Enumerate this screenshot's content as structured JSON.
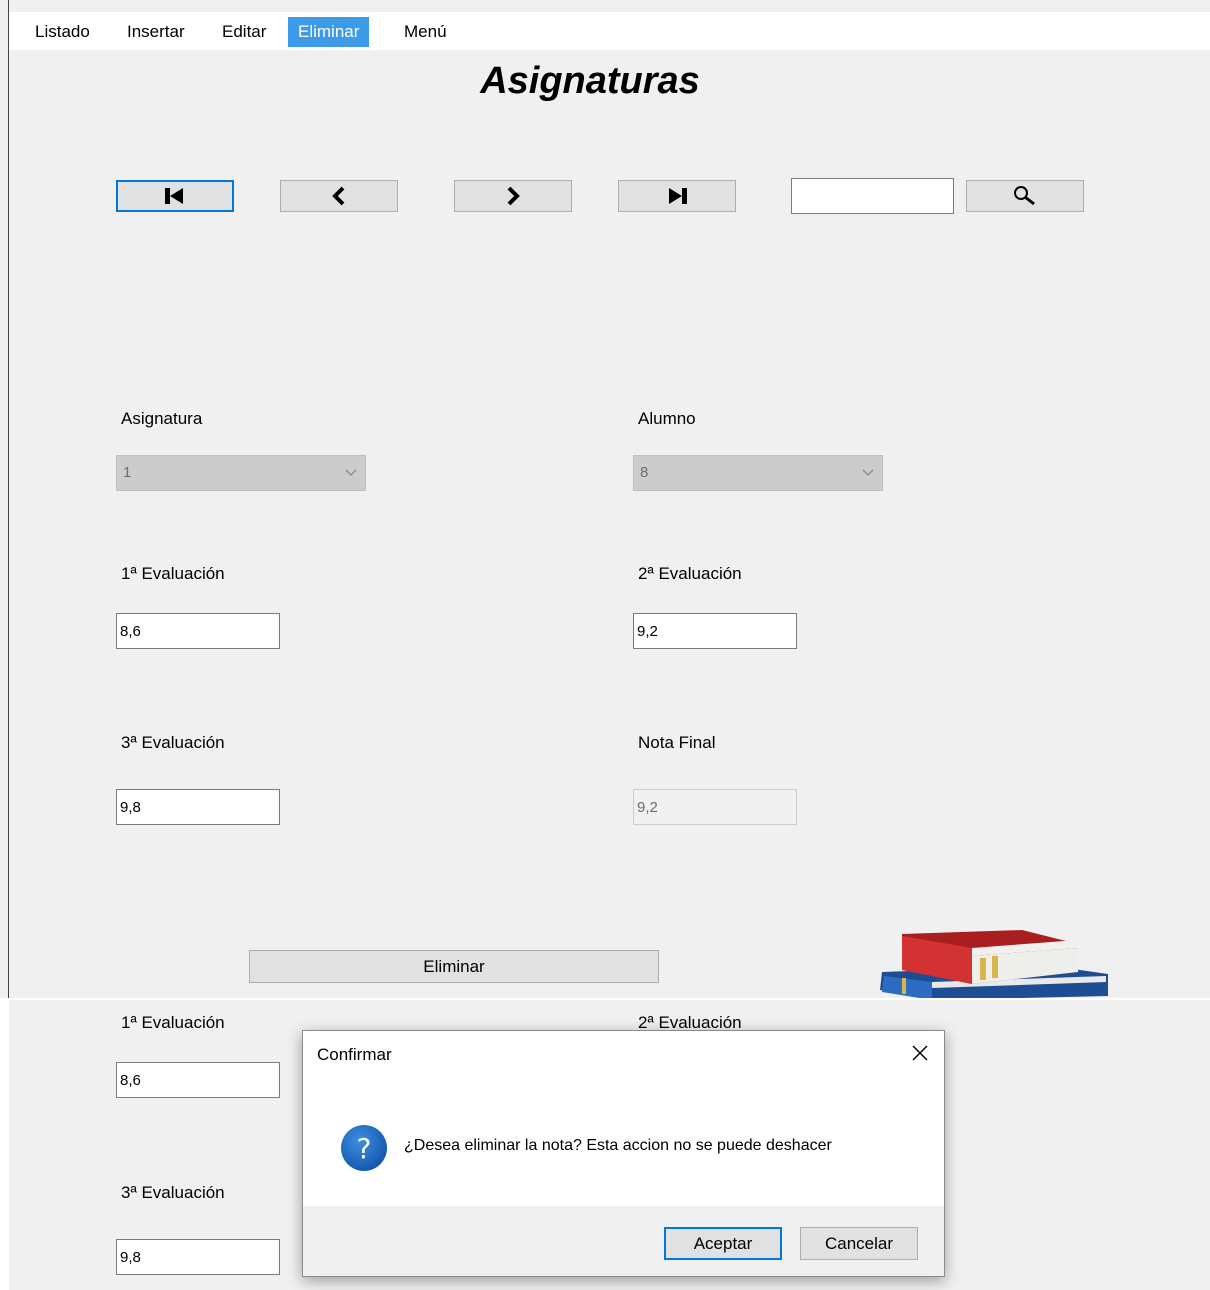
{
  "menu": {
    "items": [
      {
        "label": "Listado"
      },
      {
        "label": "Insertar"
      },
      {
        "label": "Editar"
      },
      {
        "label": "Eliminar",
        "active": true
      },
      {
        "label": "Menú"
      }
    ]
  },
  "header": {
    "title": "Asignaturas"
  },
  "nav": {
    "first_icon": "skip-first-icon",
    "prev_icon": "chevron-left-icon",
    "next_icon": "chevron-right-icon",
    "last_icon": "skip-last-icon",
    "search_value": "",
    "search_icon": "search-icon"
  },
  "form": {
    "asignatura_label": "Asignatura",
    "asignatura_value": "1",
    "alumno_label": "Alumno",
    "alumno_value": "8",
    "eval1_label": "1ª Evaluación",
    "eval1_value": "8,6",
    "eval2_label": "2ª Evaluación",
    "eval2_value": "9,2",
    "eval3_label": "3ª Evaluación",
    "eval3_value": "9,8",
    "final_label": "Nota Final",
    "final_value": "9,2",
    "delete_button": "Eliminar"
  },
  "decoration": {
    "icon": "books-icon"
  },
  "dialog": {
    "title": "Confirmar",
    "message": "¿Desea eliminar la nota? Esta accion no se puede deshacer",
    "accept": "Aceptar",
    "cancel": "Cancelar"
  },
  "colors": {
    "accent": "#0078d7",
    "menu_active": "#3c9ae8"
  }
}
